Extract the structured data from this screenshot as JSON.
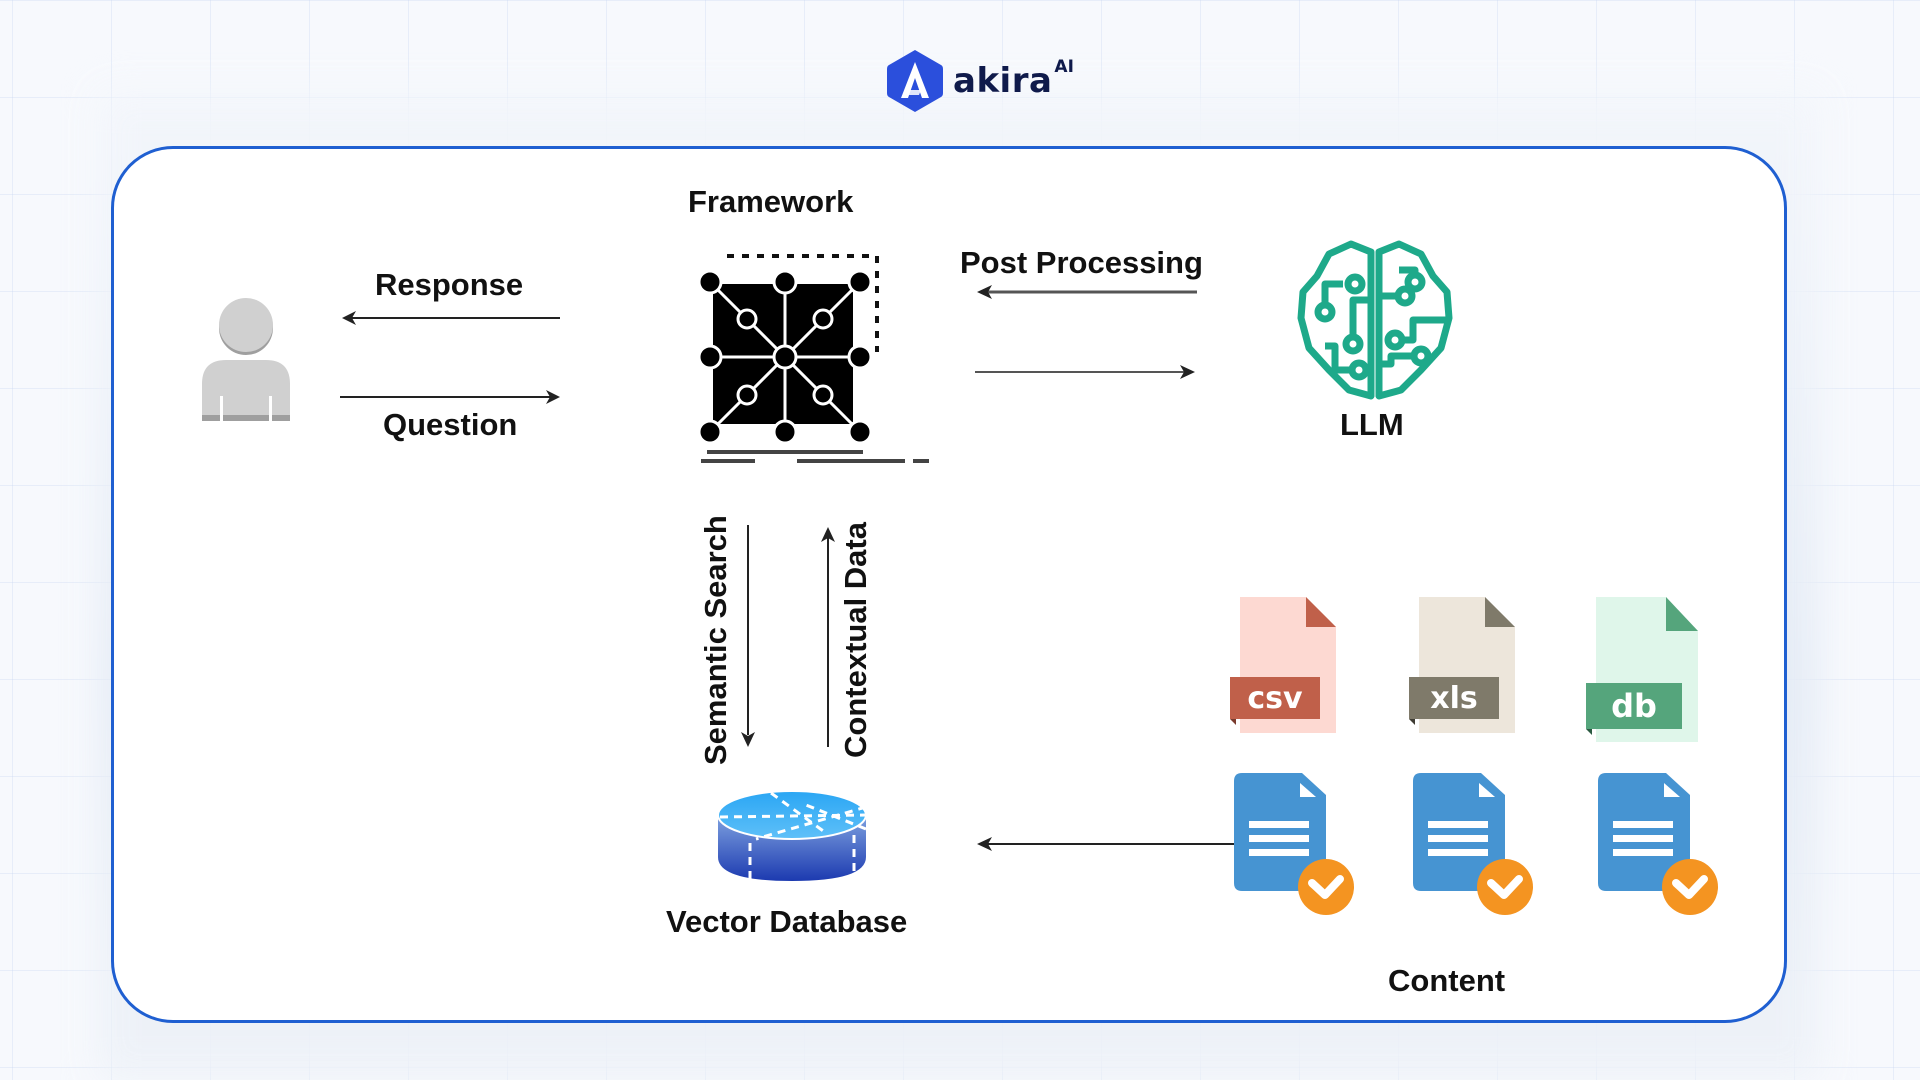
{
  "brand": {
    "name": "akira",
    "suffix": "AI",
    "color": "#2b4fdc",
    "text_color": "#0f1a4b"
  },
  "diagram": {
    "border_color": "#1f5fd1",
    "nodes": {
      "user": {
        "label": "",
        "icon": "user-icon"
      },
      "framework": {
        "label": "Framework",
        "icon": "network-grid-icon"
      },
      "llm": {
        "label": "LLM",
        "icon": "brain-circuit-icon",
        "color": "#1ea98a"
      },
      "vector_db": {
        "label": "Vector Database",
        "icon": "database-cylinder-icon"
      },
      "content": {
        "label": "Content"
      }
    },
    "edges": {
      "response": "Response",
      "question": "Question",
      "post_processing": "Post Processing",
      "semantic_search": "Semantic Search",
      "contextual_data": "Contextual Data"
    },
    "file_types": [
      {
        "ext": "csv",
        "body": "#fdd9d2",
        "accent": "#c0604a"
      },
      {
        "ext": "xls",
        "body": "#ede6db",
        "accent": "#7f7a6a"
      },
      {
        "ext": "db",
        "body": "#dff6ea",
        "accent": "#55a57c"
      }
    ],
    "documents": [
      {
        "icon": "document-check-icon",
        "doc_color": "#4694d2",
        "check_color": "#f49421"
      },
      {
        "icon": "document-check-icon",
        "doc_color": "#4694d2",
        "check_color": "#f49421"
      },
      {
        "icon": "document-check-icon",
        "doc_color": "#4694d2",
        "check_color": "#f49421"
      }
    ]
  }
}
